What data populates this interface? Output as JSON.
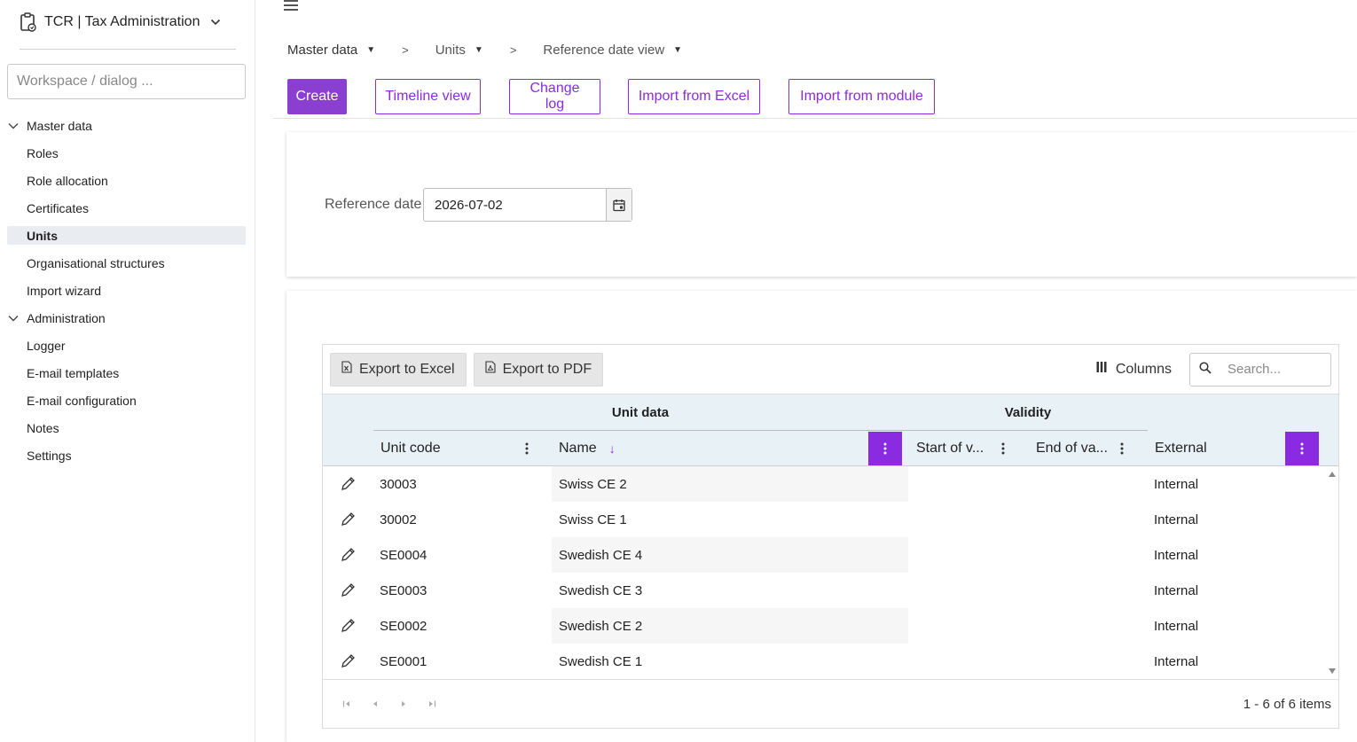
{
  "app": {
    "title": "TCR | Tax Administration"
  },
  "workspace": {
    "placeholder": "Workspace / dialog ..."
  },
  "nav": {
    "group1": "Master data",
    "group1_items": [
      "Roles",
      "Role allocation",
      "Certificates",
      "Units",
      "Organisational structures",
      "Import wizard"
    ],
    "group2": "Administration",
    "group2_items": [
      "Logger",
      "E-mail templates",
      "E-mail configuration",
      "Notes",
      "Settings"
    ]
  },
  "breadcrumb": {
    "item1": "Master data",
    "item2": "Units",
    "item3": "Reference date view",
    "sep": ">"
  },
  "toolbar": {
    "create": "Create",
    "timeline": "Timeline view",
    "changelog": "Change log",
    "import_excel": "Import from Excel",
    "import_module": "Import from module"
  },
  "filter": {
    "label": "Reference date",
    "value": "2026-07-02"
  },
  "grid": {
    "export_excel": "Export to Excel",
    "export_pdf": "Export to PDF",
    "columns": "Columns",
    "search_placeholder": "Search...",
    "group_unit": "Unit data",
    "group_validity": "Validity",
    "col_code": "Unit code",
    "col_name": "Name",
    "col_start": "Start of v...",
    "col_end": "End of va...",
    "col_external": "External",
    "rows": [
      {
        "code": "30003",
        "name": "Swiss CE 2",
        "start": "",
        "end": "",
        "external": "Internal"
      },
      {
        "code": "30002",
        "name": "Swiss CE 1",
        "start": "",
        "end": "",
        "external": "Internal"
      },
      {
        "code": "SE0004",
        "name": "Swedish CE 4",
        "start": "",
        "end": "",
        "external": "Internal"
      },
      {
        "code": "SE0003",
        "name": "Swedish CE 3",
        "start": "",
        "end": "",
        "external": "Internal"
      },
      {
        "code": "SE0002",
        "name": "Swedish CE 2",
        "start": "",
        "end": "",
        "external": "Internal"
      },
      {
        "code": "SE0001",
        "name": "Swedish CE 1",
        "start": "",
        "end": "",
        "external": "Internal"
      }
    ],
    "page_info": "1 - 6 of 6 items"
  },
  "colors": {
    "accent": "#8a2be2",
    "header_bg": "#e8f2f6",
    "active_nav": "#e9ecf0"
  }
}
